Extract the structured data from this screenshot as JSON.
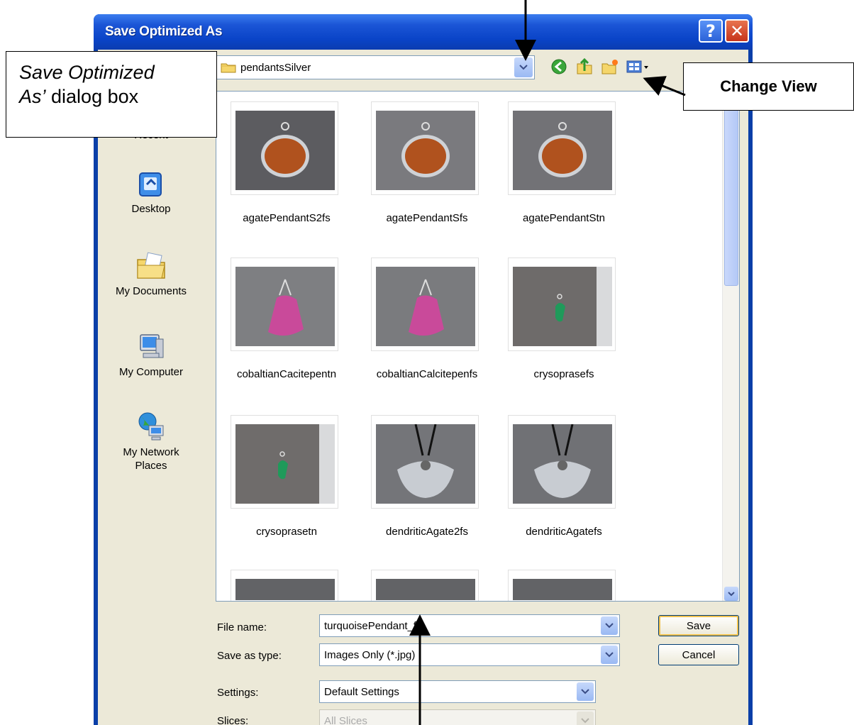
{
  "dialog": {
    "title": "Save Optimized As",
    "help_label": "?",
    "close_label": "✕"
  },
  "toolbar": {
    "folder": "pendantsSilver",
    "icons": [
      "back-icon",
      "up-folder-icon",
      "new-folder-icon",
      "views-menu-icon"
    ]
  },
  "places": [
    {
      "label": "Recent",
      "icon": "recent-icon"
    },
    {
      "label": "Desktop",
      "icon": "desktop-icon"
    },
    {
      "label": "My Documents",
      "icon": "my-documents-icon"
    },
    {
      "label": "My Computer",
      "icon": "my-computer-icon"
    },
    {
      "label": "My Network Places",
      "icon": "network-places-icon"
    }
  ],
  "files": [
    {
      "name": "agatePendantS2fs",
      "stone": "#b0521e",
      "shape": "oval",
      "bg": "#5c5c60"
    },
    {
      "name": "agatePendantSfs",
      "stone": "#b0521e",
      "shape": "oval",
      "bg": "#7a7a7e"
    },
    {
      "name": "agatePendantStn",
      "stone": "#b0521e",
      "shape": "oval",
      "bg": "#727276"
    },
    {
      "name": "cobaltianCacitepentn",
      "stone": "#c94a9a",
      "shape": "drop",
      "bg": "#7e7f82"
    },
    {
      "name": "cobaltianCalcitepenfs",
      "stone": "#c94a9a",
      "shape": "drop",
      "bg": "#7a7b7e"
    },
    {
      "name": "crysoprasefs",
      "stone": "#1f9a5a",
      "shape": "small",
      "bg": "#6e6b6a"
    },
    {
      "name": "crysoprasetn",
      "stone": "#1f9a5a",
      "shape": "small",
      "bg": "#6f6c6b"
    },
    {
      "name": "dendriticAgate2fs",
      "stone": "#c8ccd2",
      "shape": "fan",
      "bg": "#747579"
    },
    {
      "name": "dendriticAgatefs",
      "stone": "#c8ccd2",
      "shape": "fan",
      "bg": "#707175"
    }
  ],
  "form": {
    "file_name_label": "File name:",
    "file_name_value": "turquoisePendant_fs",
    "save_type_label": "Save as type:",
    "save_type_value": "Images Only (*.jpg)",
    "settings_label": "Settings:",
    "settings_value": "Default Settings",
    "slices_label": "Slices:",
    "slices_value": "All Slices",
    "save_button": "Save",
    "cancel_button": "Cancel"
  },
  "annotations": {
    "dialog_callout_line1": "Save Optimized",
    "dialog_callout_line2a": "As’",
    "dialog_callout_line2b": " dialog box",
    "change_view": "Change View"
  },
  "colors": {
    "titlebar": "#0a44c8",
    "dialog_bg": "#ece9d8",
    "field_border": "#7f9db9"
  }
}
